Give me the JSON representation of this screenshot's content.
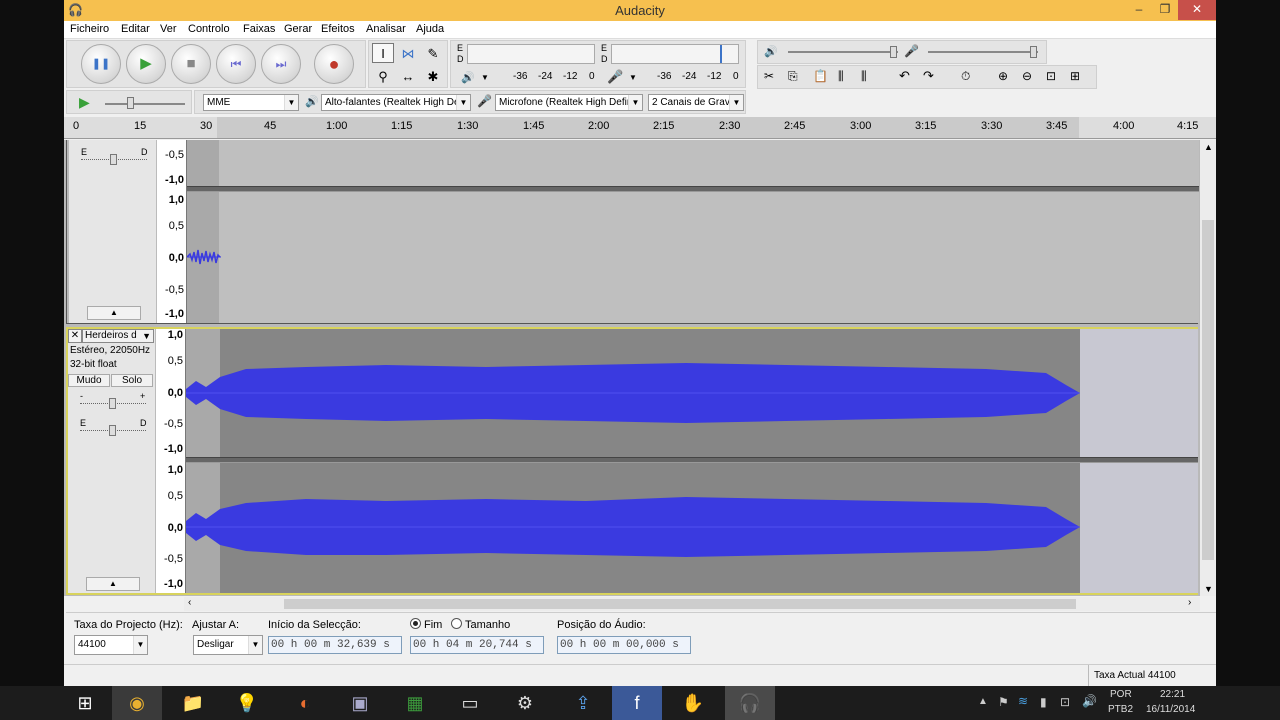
{
  "window": {
    "title": "Audacity",
    "minimize": "–",
    "restore": "❐",
    "close": "✕"
  },
  "menu": [
    "Ficheiro",
    "Editar",
    "Ver",
    "Controlo",
    "Faixas",
    "Gerar",
    "Efeitos",
    "Analisar",
    "Ajuda"
  ],
  "transport": {
    "pause": "❚❚",
    "play": "▶",
    "stop": "■",
    "skip_start": "⏮",
    "skip_end": "⏭",
    "record": "●"
  },
  "tools": {
    "select": "I",
    "envelope": "⋈",
    "draw": "✎",
    "zoom": "⚲",
    "timeshift": "↔",
    "multi": "✱"
  },
  "meters": {
    "play_left": "E",
    "play_right": "D",
    "rec_left": "E",
    "rec_right": "D",
    "play_ticks": [
      "-36",
      "-24",
      "-12",
      "0"
    ],
    "rec_ticks": [
      "-36",
      "-24",
      "-12",
      "0"
    ]
  },
  "device": {
    "host": "MME",
    "output": "Alto-falantes (Realtek High De",
    "input": "Microfone (Realtek High Defini",
    "channels": "2 Canais de Grava"
  },
  "ruler": {
    "ticks": [
      "0",
      "15",
      "30",
      "45",
      "1:00",
      "1:15",
      "1:30",
      "1:45",
      "2:00",
      "2:15",
      "2:30",
      "2:45",
      "3:00",
      "3:15",
      "3:30",
      "3:45",
      "4:00",
      "4:15"
    ]
  },
  "track1": {
    "pan_left": "E",
    "pan_right": "D",
    "top_labels": [
      "-0,5",
      "-1,0"
    ],
    "labels": [
      "1,0",
      "0,5",
      "0,0",
      "-0,5",
      "-1,0"
    ]
  },
  "track2": {
    "name": "Herdeiros d",
    "info1": "Estéreo, 22050Hz",
    "info2": "32-bit float",
    "mute": "Mudo",
    "solo": "Solo",
    "gain_minus": "-",
    "gain_plus": "+",
    "pan_left": "E",
    "pan_right": "D",
    "labels_l": [
      "1,0",
      "0,5",
      "0,0",
      "-0,5",
      "-1,0"
    ],
    "labels_r": [
      "1,0",
      "0,5",
      "0,0",
      "-0,5",
      "-1,0"
    ]
  },
  "selbar": {
    "rate_label": "Taxa do Projecto (Hz):",
    "rate": "44100",
    "snap_label": "Ajustar A:",
    "snap": "Desligar",
    "start_label": "Início da Selecção:",
    "start": "00 h 00 m 32,639 s",
    "end_label": "Fim",
    "length_label": "Tamanho",
    "end": "00 h 04 m 20,744 s",
    "pos_label": "Posição do Áudio:",
    "pos": "00 h 00 m 00,000 s"
  },
  "status": {
    "rate": "Taxa Actual 44100"
  },
  "taskbar": {
    "lang1": "POR",
    "lang2": "PTB2",
    "time": "22:21",
    "date": "16/11/2014"
  },
  "colors": {
    "title": "#f6c04f",
    "wave": "#3a3ae0",
    "selected_bg": "#8a8a8a",
    "track_bg": "#bfbfbf"
  }
}
